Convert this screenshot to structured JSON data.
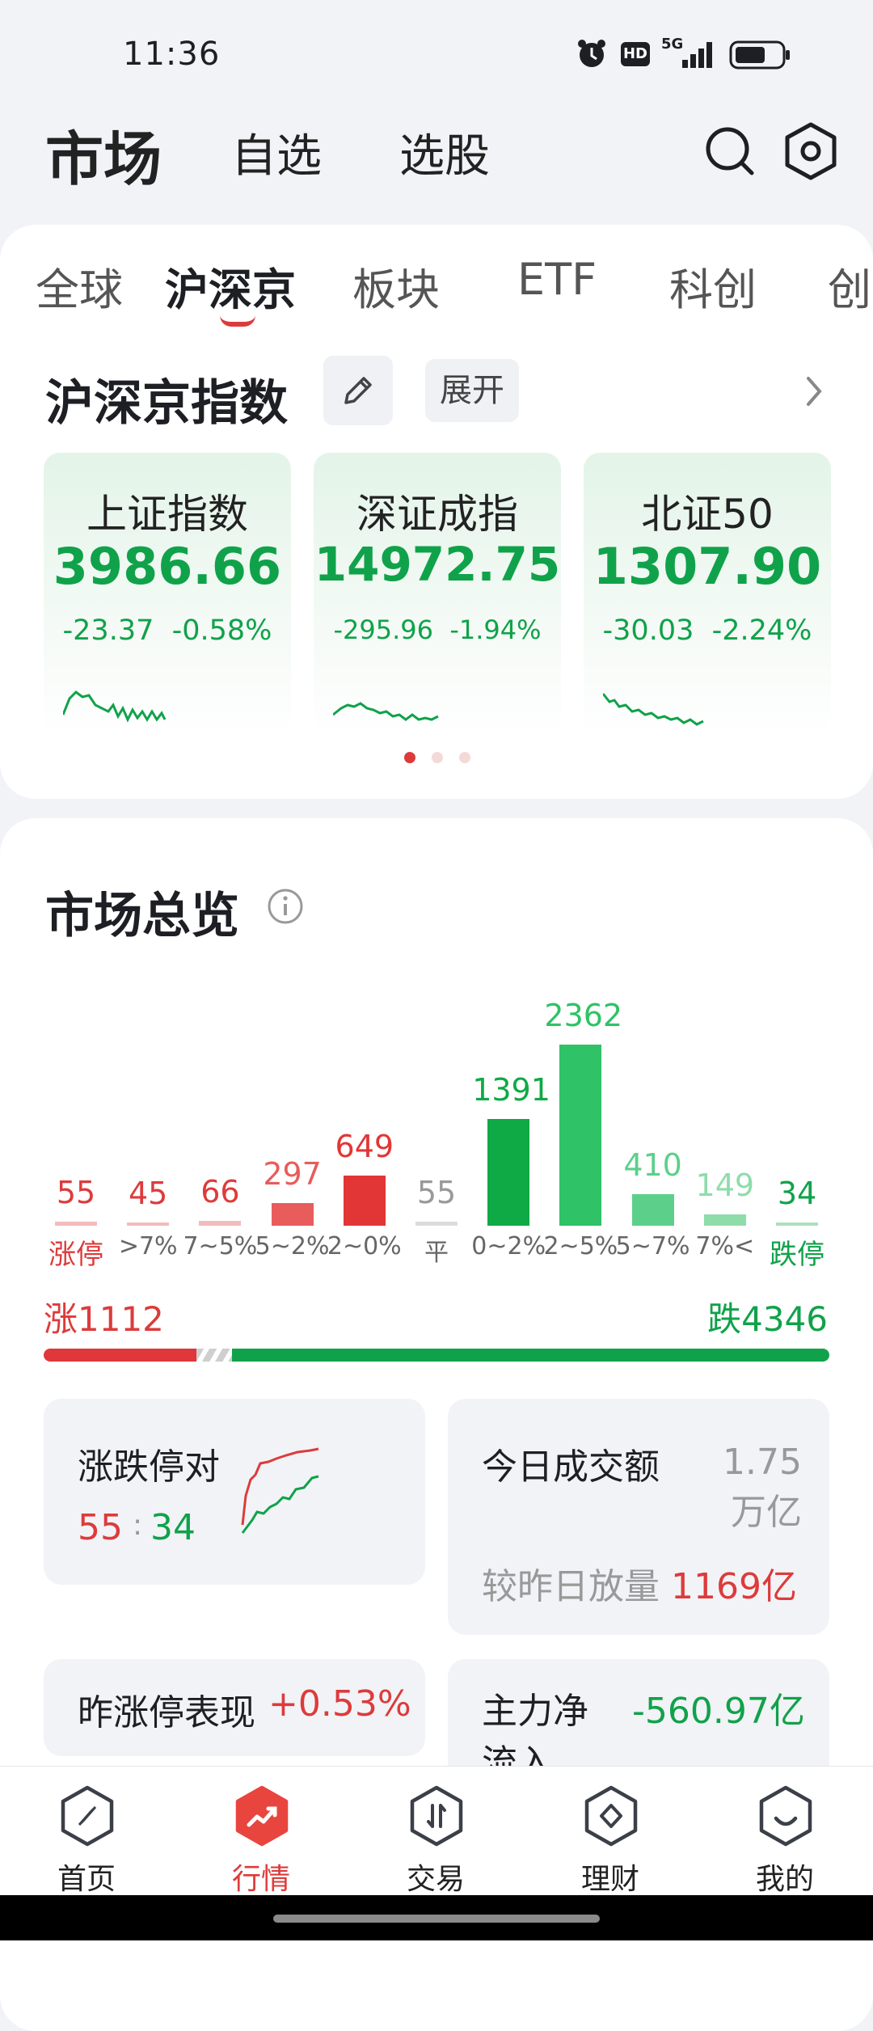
{
  "status_bar": {
    "time": "11:36",
    "network": "5G",
    "hd": "HD"
  },
  "header": {
    "tabs": [
      "市场",
      "自选",
      "选股"
    ],
    "active_tab": "市场"
  },
  "market_tabs": {
    "items": [
      "全球",
      "沪深京",
      "板块",
      "ETF",
      "科创",
      "创"
    ],
    "active": "沪深京"
  },
  "index_section": {
    "title": "沪深京指数",
    "expand_label": "展开",
    "cards": [
      {
        "name": "上证指数",
        "price": "3986.66",
        "change": "-23.37",
        "pct": "-0.58%"
      },
      {
        "name": "深证成指",
        "price": "14972.75",
        "change": "-295.96",
        "pct": "-1.94%"
      },
      {
        "name": "北证50",
        "price": "1307.90",
        "change": "-30.03",
        "pct": "-2.24%"
      }
    ],
    "page_dots": 3,
    "active_dot": 0
  },
  "overview": {
    "title": "市场总览",
    "chart_data": {
      "type": "bar",
      "categories": [
        "涨停",
        ">7%",
        "7~5%",
        "5~2%",
        "2~0%",
        "平",
        "0~2%",
        "2~5%",
        "5~7%",
        "7%<",
        "跌停"
      ],
      "values": [
        55,
        45,
        66,
        297,
        649,
        55,
        1391,
        2362,
        410,
        149,
        34
      ],
      "value_labels": [
        "55",
        "45",
        "66",
        "297",
        "649",
        "55",
        "1391",
        "2362",
        "410",
        "149",
        "34"
      ],
      "colors": [
        "#dd3b3b",
        "#dd3b3b",
        "#dd3b3b",
        "#e85c5c",
        "#e23636",
        "#999999",
        "#0fa945",
        "#2fc266",
        "#5cd08a",
        "#8fdcab",
        "#10a24a"
      ]
    },
    "rise_label": "涨1112",
    "fall_label": "跌4346",
    "rise_count": 1112,
    "fall_count": 4346,
    "limit_pair": {
      "title": "涨跌停对",
      "up": "55",
      "sep": ":",
      "down": "34"
    },
    "turnover": {
      "title": "今日成交额",
      "value": "1.75万亿",
      "compare_label": "较昨日放量",
      "compare_value": "1169亿"
    },
    "yesterday_limit": {
      "title": "昨涨停表现",
      "value": "+0.53%"
    },
    "main_flow": {
      "title_line1": "主力净",
      "title_line2": "流入",
      "value": "-560.97亿"
    }
  },
  "bottom_nav": {
    "items": [
      {
        "label": "首页",
        "icon": "compass-icon"
      },
      {
        "label": "行情",
        "icon": "trend-icon"
      },
      {
        "label": "交易",
        "icon": "trade-icon"
      },
      {
        "label": "理财",
        "icon": "wealth-icon"
      },
      {
        "label": "我的",
        "icon": "profile-icon"
      }
    ],
    "active": "行情"
  },
  "colors": {
    "accent_red": "#dd3b3b",
    "accent_green": "#10a24a",
    "background": "#f2f3f7"
  }
}
